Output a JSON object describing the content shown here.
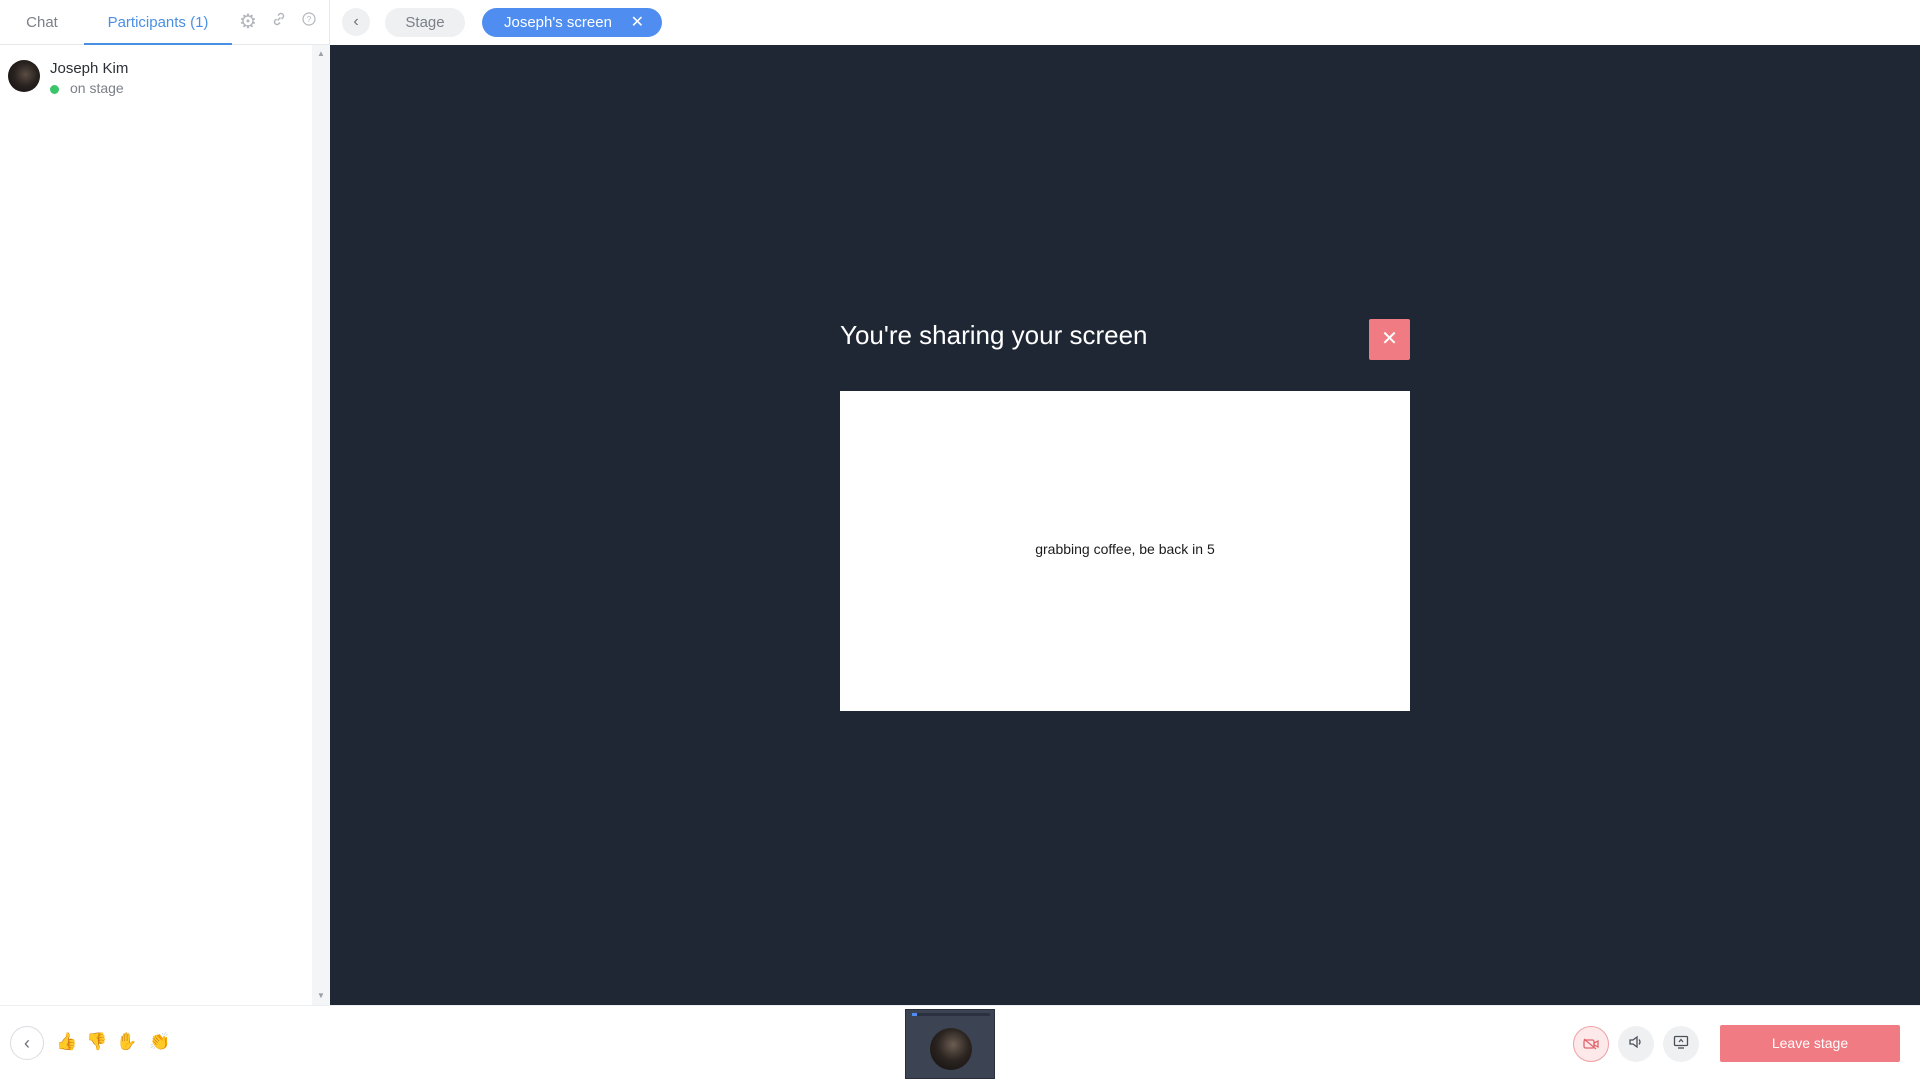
{
  "sidebar": {
    "tabs": [
      {
        "label": "Chat"
      },
      {
        "label": "Participants (1)"
      }
    ],
    "icons": [
      "gear-icon",
      "link-icon",
      "help-icon"
    ],
    "participants": [
      {
        "name": "Joseph Kim",
        "status": "on stage",
        "status_color": "#3bc56b"
      }
    ]
  },
  "topbar": {
    "back_icon": "chevron-left-icon",
    "pills": [
      {
        "label": "Stage"
      },
      {
        "label": "Joseph's screen",
        "active": true
      }
    ]
  },
  "stage": {
    "share_title": "You're sharing your screen",
    "preview_text": "grabbing coffee, be back in 5",
    "background_color": "#202734",
    "close_color": "#f07b82"
  },
  "bottombar": {
    "reactions": [
      "thumbs-up-icon",
      "thumbs-down-icon",
      "raise-hand-icon",
      "clap-icon"
    ],
    "controls": [
      "camera-off-icon",
      "audio-icon",
      "screen-share-icon"
    ],
    "leave_label": "Leave stage",
    "accent": "#4f8ef0",
    "danger": "#f07b82"
  }
}
